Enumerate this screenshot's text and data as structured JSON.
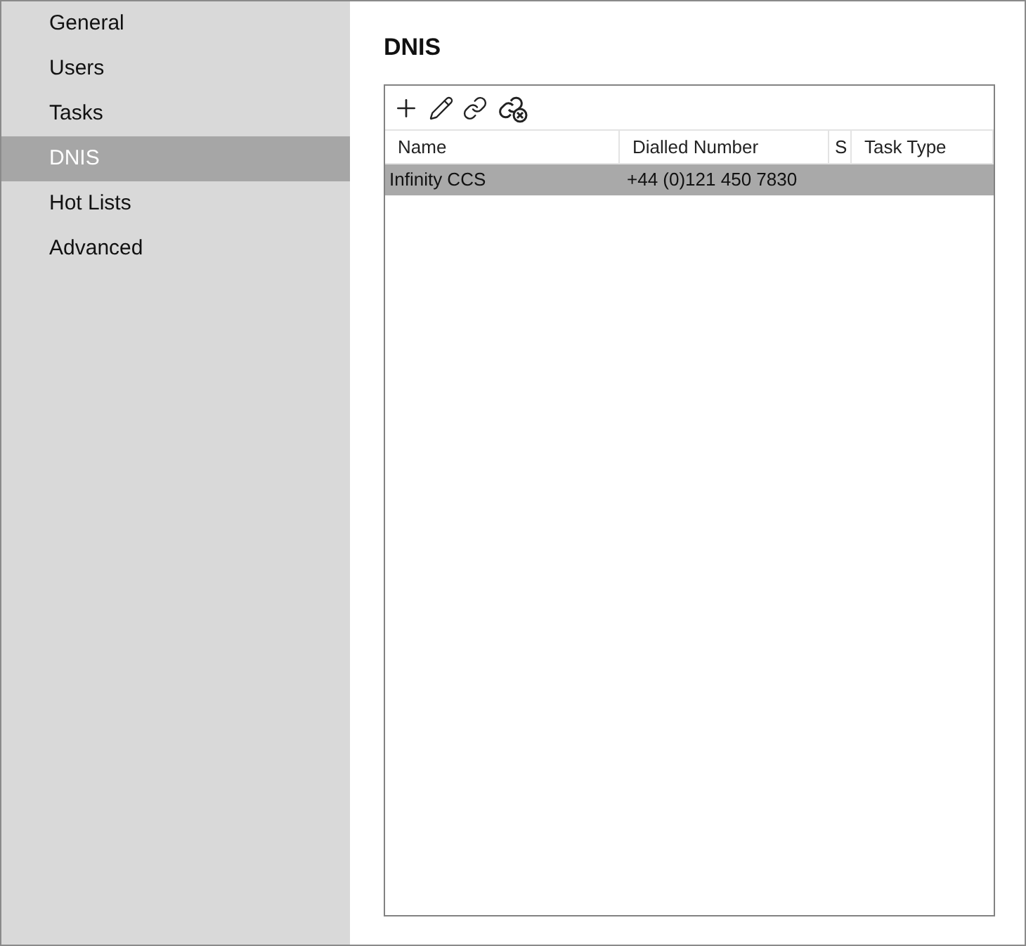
{
  "sidebar": {
    "items": [
      {
        "label": "General",
        "selected": false
      },
      {
        "label": "Users",
        "selected": false
      },
      {
        "label": "Tasks",
        "selected": false
      },
      {
        "label": "DNIS",
        "selected": true
      },
      {
        "label": "Hot Lists",
        "selected": false
      },
      {
        "label": "Advanced",
        "selected": false
      }
    ]
  },
  "page": {
    "title": "DNIS"
  },
  "table": {
    "columns": [
      "Name",
      "Dialled Number",
      "S",
      "Task Type"
    ],
    "rows": [
      {
        "cells": [
          "Infinity CCS",
          "+44 (0)121 450 7830",
          "",
          ""
        ],
        "selected": true
      }
    ]
  }
}
